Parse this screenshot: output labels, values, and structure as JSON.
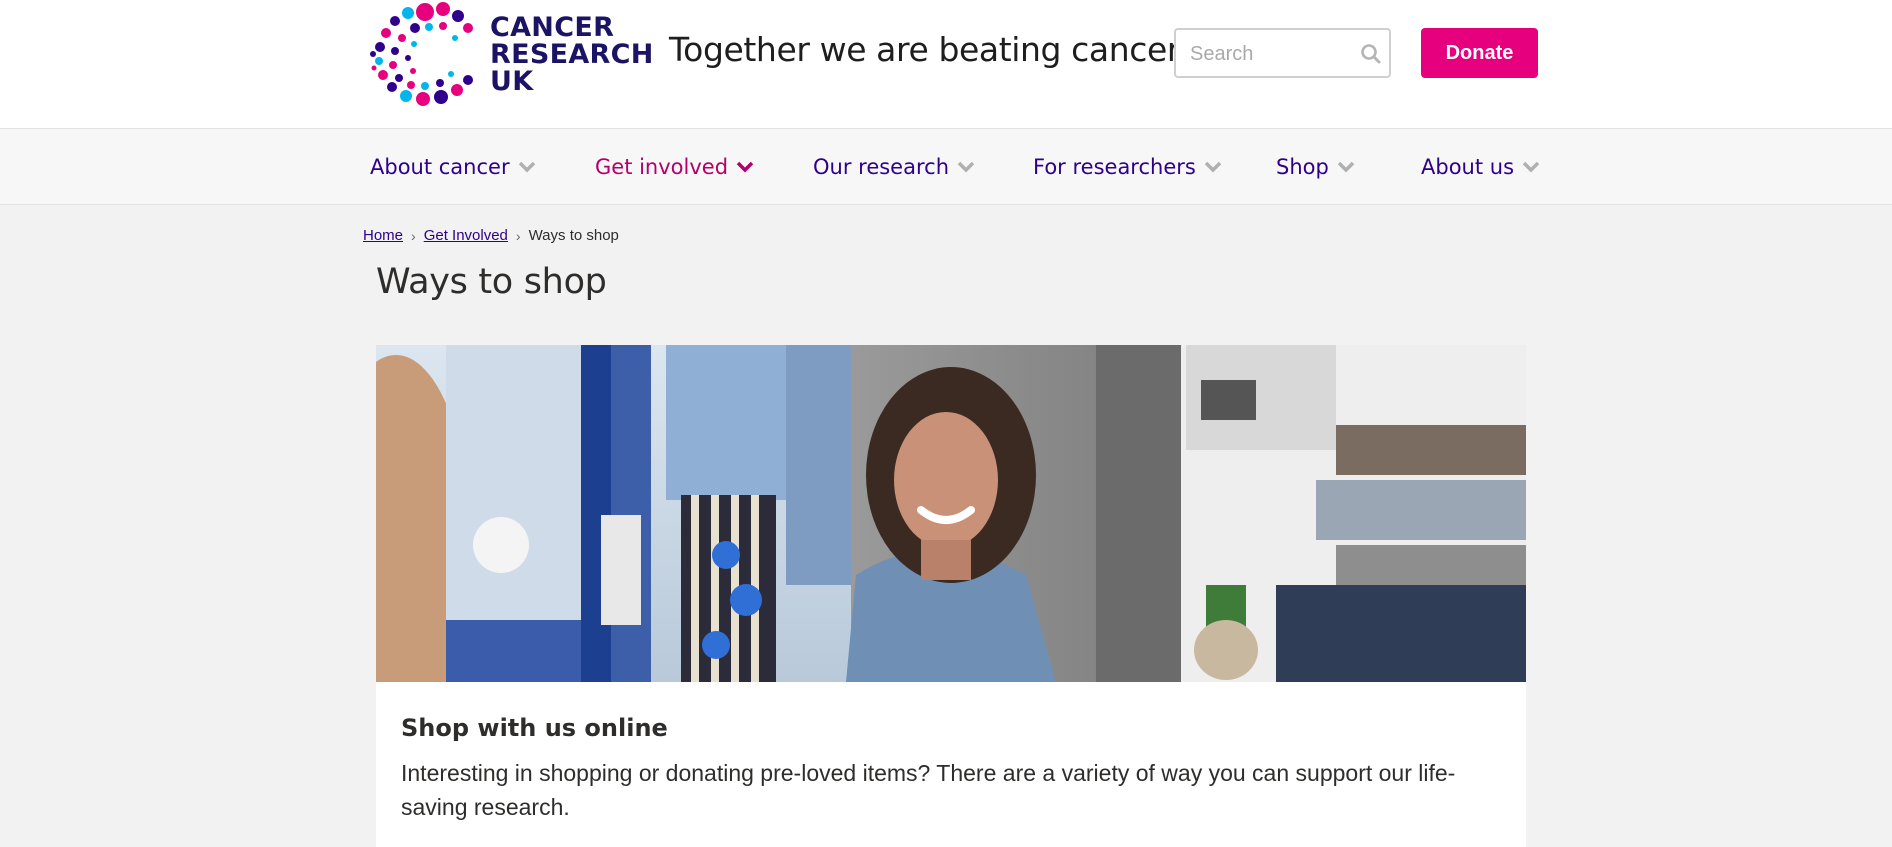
{
  "header": {
    "logo_lines": [
      "CANCER",
      "RESEARCH",
      "UK"
    ],
    "tagline": "Together we are beating cancer",
    "search_placeholder": "Search",
    "donate_label": "Donate"
  },
  "nav": {
    "items": [
      {
        "label": "About cancer",
        "active": false
      },
      {
        "label": "Get involved",
        "active": true
      },
      {
        "label": "Our research",
        "active": false
      },
      {
        "label": "For researchers",
        "active": false
      },
      {
        "label": "Shop",
        "active": false
      },
      {
        "label": "About us",
        "active": false
      }
    ]
  },
  "breadcrumb": {
    "home": "Home",
    "parent": "Get Involved",
    "current": "Ways to shop",
    "separator": "›"
  },
  "page": {
    "title": "Ways to shop"
  },
  "card": {
    "title": "Shop with us online",
    "text": "Interesting in shopping or donating pre-loved items? There are a variety of way you can support our life-saving research."
  },
  "colors": {
    "brand_pink": "#e6007e",
    "brand_navy": "#2e008b",
    "active_nav": "#b3006b"
  }
}
